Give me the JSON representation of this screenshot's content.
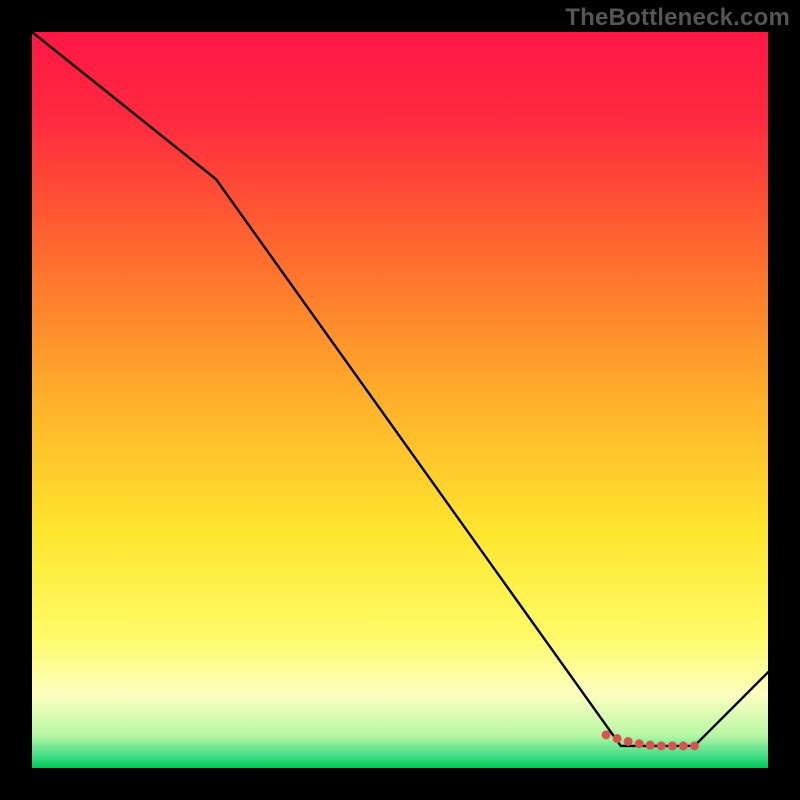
{
  "watermark": "TheBottleneck.com",
  "chart_data": {
    "type": "line",
    "title": "",
    "xlabel": "",
    "ylabel": "",
    "xlim": [
      0,
      100
    ],
    "ylim": [
      0,
      100
    ],
    "gradient_stops": [
      {
        "offset": 0.0,
        "color": "#ff1744"
      },
      {
        "offset": 0.12,
        "color": "#ff2a3f"
      },
      {
        "offset": 0.3,
        "color": "#ff6a2e"
      },
      {
        "offset": 0.5,
        "color": "#ffb02a"
      },
      {
        "offset": 0.68,
        "color": "#ffe62e"
      },
      {
        "offset": 0.82,
        "color": "#fffb66"
      },
      {
        "offset": 0.9,
        "color": "#fdffc0"
      },
      {
        "offset": 0.955,
        "color": "#b8f7a6"
      },
      {
        "offset": 0.985,
        "color": "#3ddc84"
      },
      {
        "offset": 1.0,
        "color": "#00c853"
      }
    ],
    "series": [
      {
        "name": "curve",
        "x": [
          0,
          25,
          80,
          90,
          100
        ],
        "y": [
          100,
          80,
          3,
          3,
          13
        ]
      }
    ],
    "markers": {
      "name": "optimal-band",
      "color": "#d9534f",
      "x": [
        78,
        79.5,
        81,
        82.5,
        84,
        85.5,
        87,
        88.5,
        90
      ],
      "y": [
        4.5,
        4.0,
        3.6,
        3.3,
        3.1,
        3.0,
        3.0,
        3.0,
        3.0
      ]
    }
  }
}
